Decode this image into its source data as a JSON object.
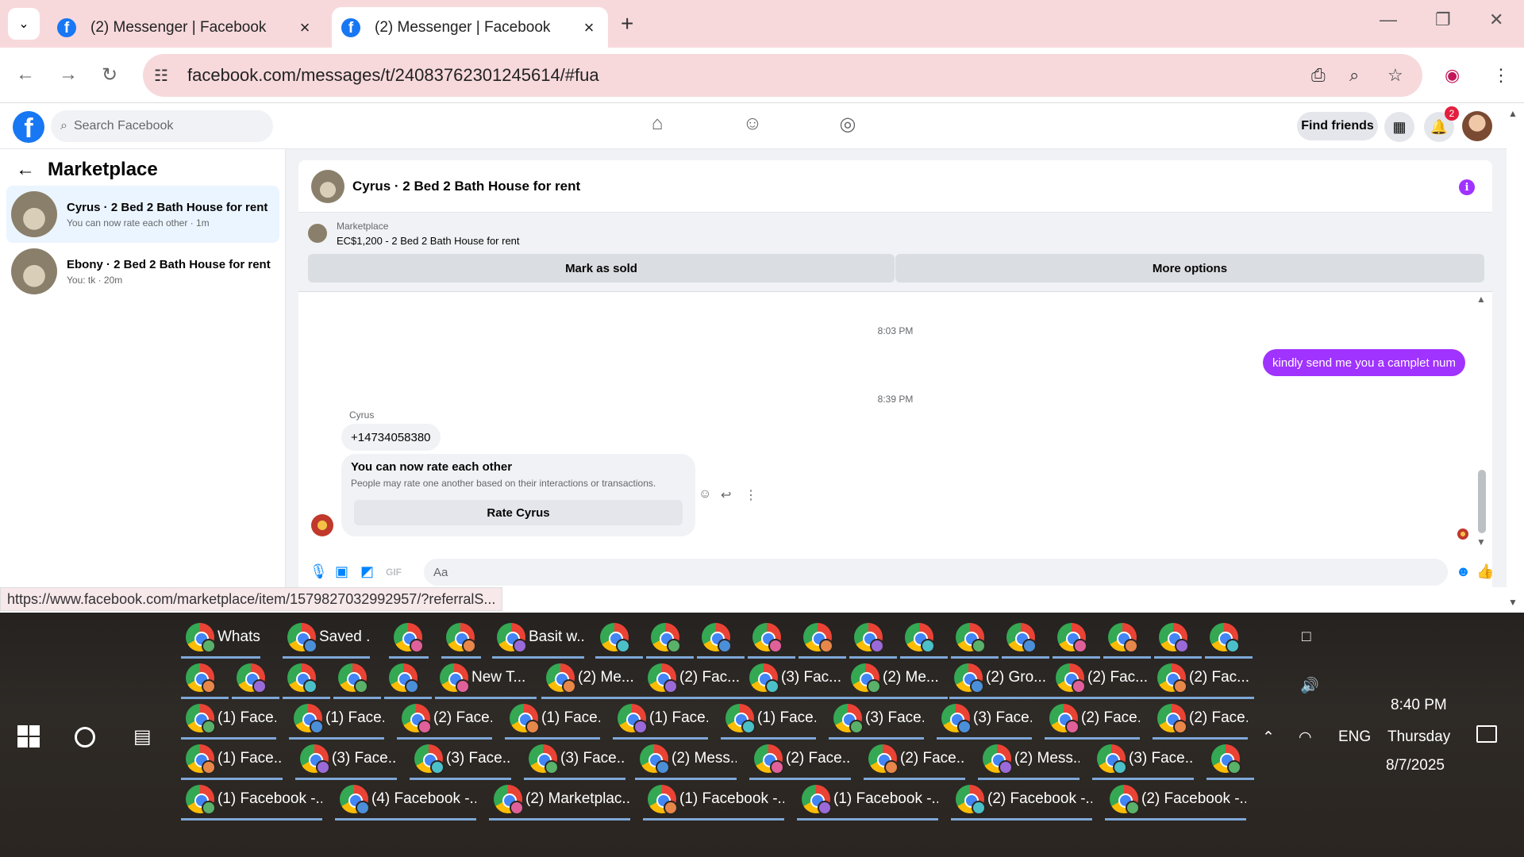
{
  "browser": {
    "tabs": [
      {
        "title": "(2) Messenger | Facebook"
      },
      {
        "title": "(2) Messenger | Facebook"
      }
    ],
    "url": "facebook.com/messages/t/24083762301245614/#fua",
    "status_url": "https://www.facebook.com/marketplace/item/1579827032992957/?referralS..."
  },
  "facebook": {
    "search_placeholder": "Search Facebook",
    "find_friends": "Find friends",
    "notification_count": "2",
    "logo_letter": "f"
  },
  "left_panel": {
    "title": "Marketplace",
    "conversations": [
      {
        "name": "Cyrus · 2 Bed 2 Bath House for rent",
        "preview": "You can now rate each other · 1m"
      },
      {
        "name": "Ebony · 2 Bed 2 Bath House for rent",
        "preview": "You: tk · 20m"
      }
    ]
  },
  "chat": {
    "header_name": "Cyrus · 2 Bed 2 Bath House for rent",
    "listing": {
      "label": "Marketplace",
      "detail": "EC$1,200 - 2 Bed 2 Bath House for rent",
      "mark_sold": "Mark as sold",
      "more_options": "More options"
    },
    "time1": "8:03 PM",
    "outgoing": "kindly send me you a camplet num",
    "time2": "8:39 PM",
    "sender": "Cyrus",
    "incoming": "+14734058380",
    "rate_card": {
      "heading": "You can now rate each other",
      "sub": "People may rate one another based on their interactions or transactions.",
      "button": "Rate Cyrus"
    },
    "composer_placeholder": "Aa"
  },
  "taskbar": {
    "row1": [
      "Whats...",
      "Saved ...",
      "",
      "",
      "Basit w...",
      "",
      "",
      "",
      "",
      "",
      "",
      "",
      "",
      "",
      "",
      "",
      "",
      ""
    ],
    "row2": [
      "",
      "",
      "",
      "",
      "",
      "New T...",
      "(2) Me...",
      "(2) Fac...",
      "(3) Fac...",
      "(2) Me...",
      "(2) Gro...",
      "(2) Fac...",
      "(2) Fac..."
    ],
    "row3": [
      "(1) Face...",
      "(1) Face...",
      "(2) Face...",
      "(1) Face...",
      "(1) Face...",
      "(1) Face...",
      "(3) Face...",
      "(3) Face...",
      "(2) Face...",
      "(2) Face..."
    ],
    "row4": [
      "(1) Face...",
      "(3) Face...",
      "(3) Face...",
      "(3) Face...",
      "(2) Mess...",
      "(2) Face...",
      "(2) Face...",
      "(2) Mess...",
      "(3) Face...",
      ""
    ],
    "row5": [
      "(1) Facebook -...",
      "(4) Facebook -...",
      "(2) Marketplac...",
      "(1) Facebook -...",
      "(1) Facebook -...",
      "(2) Facebook -...",
      "(2) Facebook -..."
    ],
    "language": "ENG",
    "time": "8:40 PM",
    "day": "Thursday",
    "date": "8/7/2025"
  },
  "colors": {
    "tabstrip": "#f7d9dc",
    "facebook_blue": "#1877f2",
    "messenger_purple": "#a033ff"
  }
}
